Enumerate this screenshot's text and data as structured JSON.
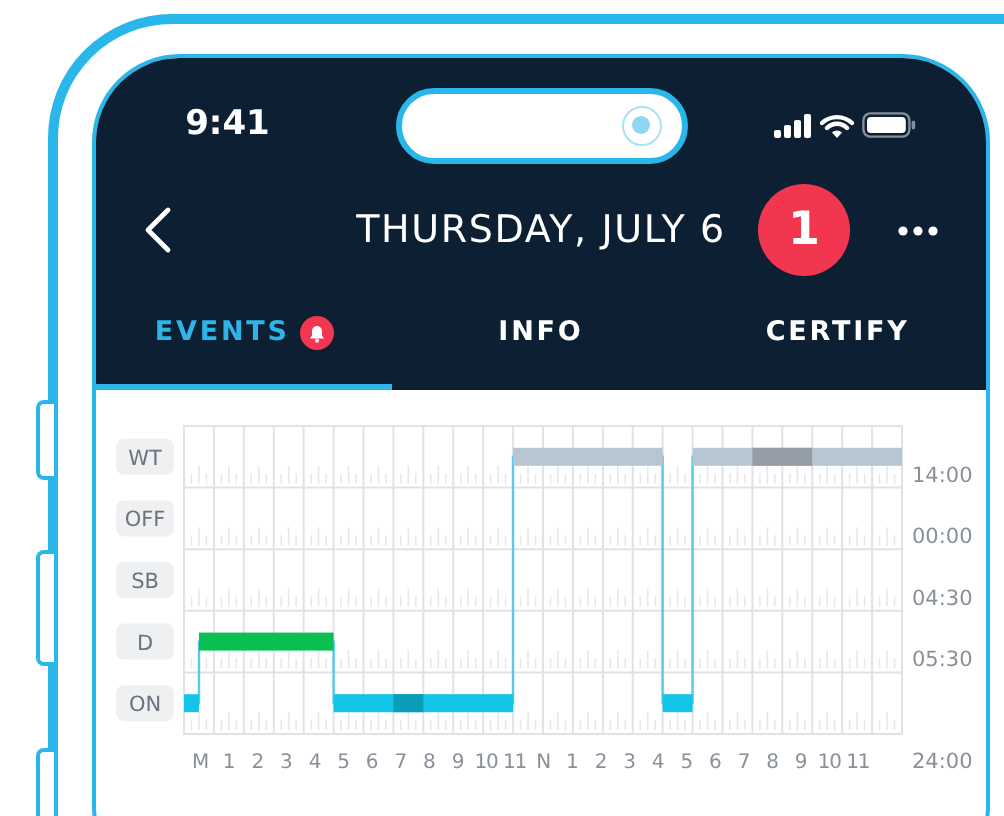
{
  "status_bar": {
    "time": "9:41"
  },
  "header": {
    "title": "THURSDAY, JULY 6",
    "badge": "1"
  },
  "tabs": [
    {
      "label": "EVENTS",
      "selected": true,
      "alert": true
    },
    {
      "label": "INFO",
      "selected": false,
      "alert": false
    },
    {
      "label": "CERTIFY",
      "selected": false,
      "alert": false
    }
  ],
  "log_chart": {
    "row_labels": [
      "WT",
      "OFF",
      "SB",
      "D",
      "ON"
    ],
    "hour_labels": [
      "M",
      "1",
      "2",
      "3",
      "4",
      "5",
      "6",
      "7",
      "8",
      "9",
      "10",
      "11",
      "N",
      "1",
      "2",
      "3",
      "4",
      "5",
      "6",
      "7",
      "8",
      "9",
      "10",
      "11"
    ],
    "totals": [
      "14:00",
      "00:00",
      "04:30",
      "05:30"
    ],
    "total": "24:00"
  }
}
